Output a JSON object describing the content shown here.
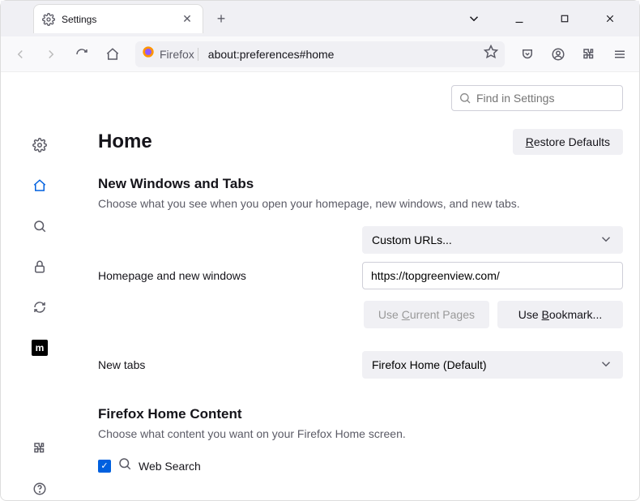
{
  "tab": {
    "title": "Settings"
  },
  "urlbar": {
    "brand": "Firefox",
    "address": "about:preferences#home"
  },
  "search": {
    "placeholder": "Find in Settings"
  },
  "page": {
    "title": "Home",
    "restore": "Restore Defaults",
    "section1": {
      "heading": "New Windows and Tabs",
      "desc": "Choose what you see when you open your homepage, new windows, and new tabs.",
      "homepage_label": "Homepage and new windows",
      "homepage_select": "Custom URLs...",
      "homepage_url": "https://topgreenview.com/",
      "use_current": "Use Current Pages",
      "use_bookmark": "Use Bookmark...",
      "newtabs_label": "New tabs",
      "newtabs_select": "Firefox Home (Default)"
    },
    "section2": {
      "heading": "Firefox Home Content",
      "desc": "Choose what content you want on your Firefox Home screen.",
      "websearch": "Web Search"
    }
  }
}
